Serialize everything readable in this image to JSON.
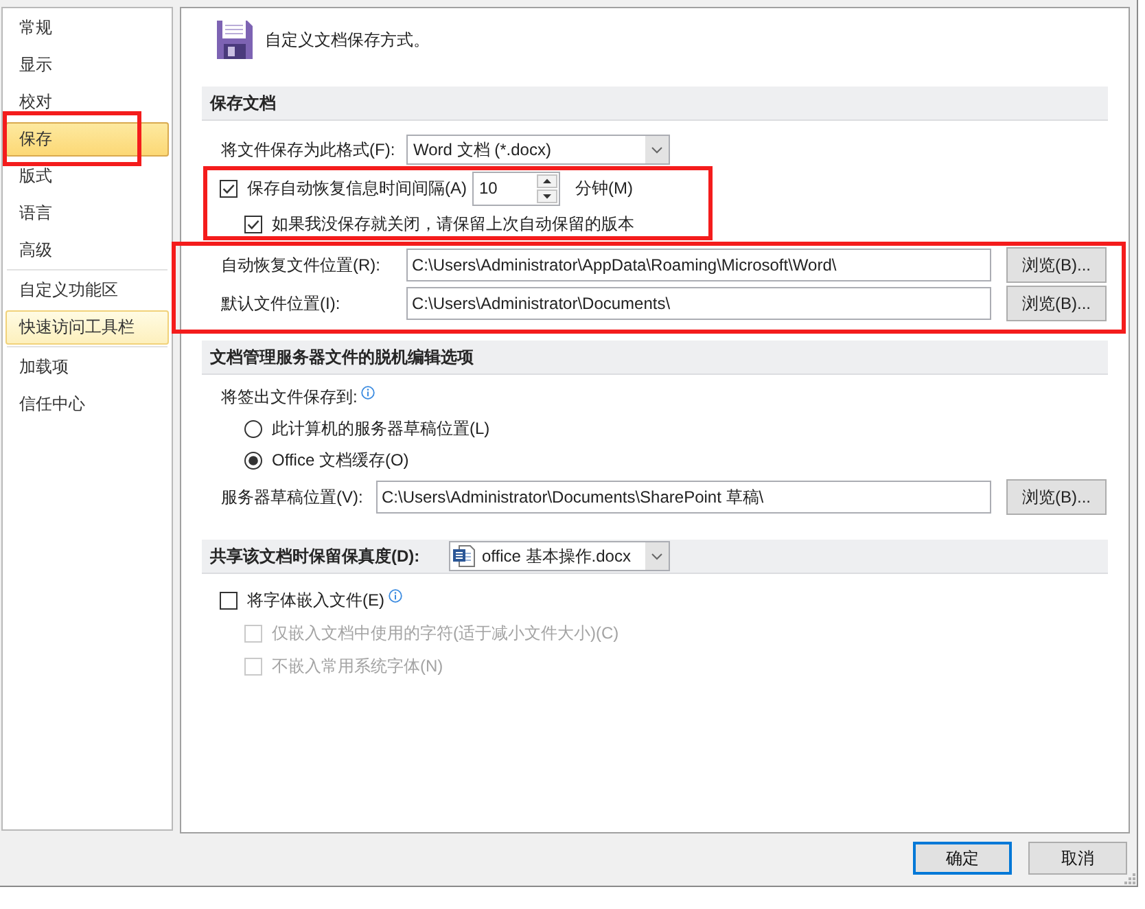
{
  "sidebar": {
    "groups": [
      {
        "items": [
          {
            "label": "常规",
            "selected": false,
            "hovered": false,
            "framed": false
          },
          {
            "label": "显示",
            "selected": false,
            "hovered": false,
            "framed": false
          },
          {
            "label": "校对",
            "selected": false,
            "hovered": false,
            "framed": false
          },
          {
            "label": "保存",
            "selected": true,
            "hovered": false,
            "framed": true
          },
          {
            "label": "版式",
            "selected": false,
            "hovered": false,
            "framed": false
          },
          {
            "label": "语言",
            "selected": false,
            "hovered": false,
            "framed": false
          },
          {
            "label": "高级",
            "selected": false,
            "hovered": false,
            "framed": false
          }
        ]
      },
      {
        "items": [
          {
            "label": "自定义功能区",
            "selected": false,
            "hovered": false,
            "framed": false
          },
          {
            "label": "快速访问工具栏",
            "selected": false,
            "hovered": true,
            "framed": false
          }
        ]
      },
      {
        "items": [
          {
            "label": "加载项",
            "selected": false,
            "hovered": false,
            "framed": false
          },
          {
            "label": "信任中心",
            "selected": false,
            "hovered": false,
            "framed": false
          }
        ]
      }
    ]
  },
  "header": {
    "text": "自定义文档保存方式。"
  },
  "save_section": {
    "title": "保存文档",
    "format": {
      "label": "将文件保存为此格式(F):",
      "value": "Word 文档 (*.docx)"
    },
    "autosave_group": {
      "framed": true,
      "autosave": {
        "label": "保存自动恢复信息时间间隔(A)",
        "checked": true,
        "value": "10",
        "unit": "分钟(M)"
      },
      "keep_last": {
        "label": "如果我没保存就关闭，请保留上次自动保留的版本",
        "checked": true
      }
    },
    "locations_group": {
      "framed": true,
      "rows": [
        {
          "label": "自动恢复文件位置(R):",
          "value": "C:\\Users\\Administrator\\AppData\\Roaming\\Microsoft\\Word\\",
          "button": "浏览(B)..."
        },
        {
          "label": "默认文件位置(I):",
          "value": "C:\\Users\\Administrator\\Documents\\",
          "button": "浏览(B)..."
        }
      ]
    }
  },
  "offline_section": {
    "title": "文档管理服务器文件的脱机编辑选项",
    "save_to_label": "将签出文件保存到:",
    "options": [
      {
        "label": "此计算机的服务器草稿位置(L)",
        "selected": false
      },
      {
        "label": "Office 文档缓存(O)",
        "selected": true
      }
    ],
    "drafts": {
      "label": "服务器草稿位置(V):",
      "value": "C:\\Users\\Administrator\\Documents\\SharePoint 草稿\\",
      "button": "浏览(B)..."
    }
  },
  "fidelity_section": {
    "title": "共享该文档时保留保真度(D):",
    "document": "office 基本操作.docx",
    "options": [
      {
        "label": "将字体嵌入文件(E)",
        "checked": false,
        "disabled": false,
        "children": [
          {
            "label": "仅嵌入文档中使用的字符(适于减小文件大小)(C)",
            "checked": false,
            "disabled": true
          },
          {
            "label": "不嵌入常用系统字体(N)",
            "checked": false,
            "disabled": true
          }
        ]
      }
    ]
  },
  "buttons": [
    {
      "label": "确定",
      "default": true
    },
    {
      "label": "取消",
      "default": false
    }
  ]
}
